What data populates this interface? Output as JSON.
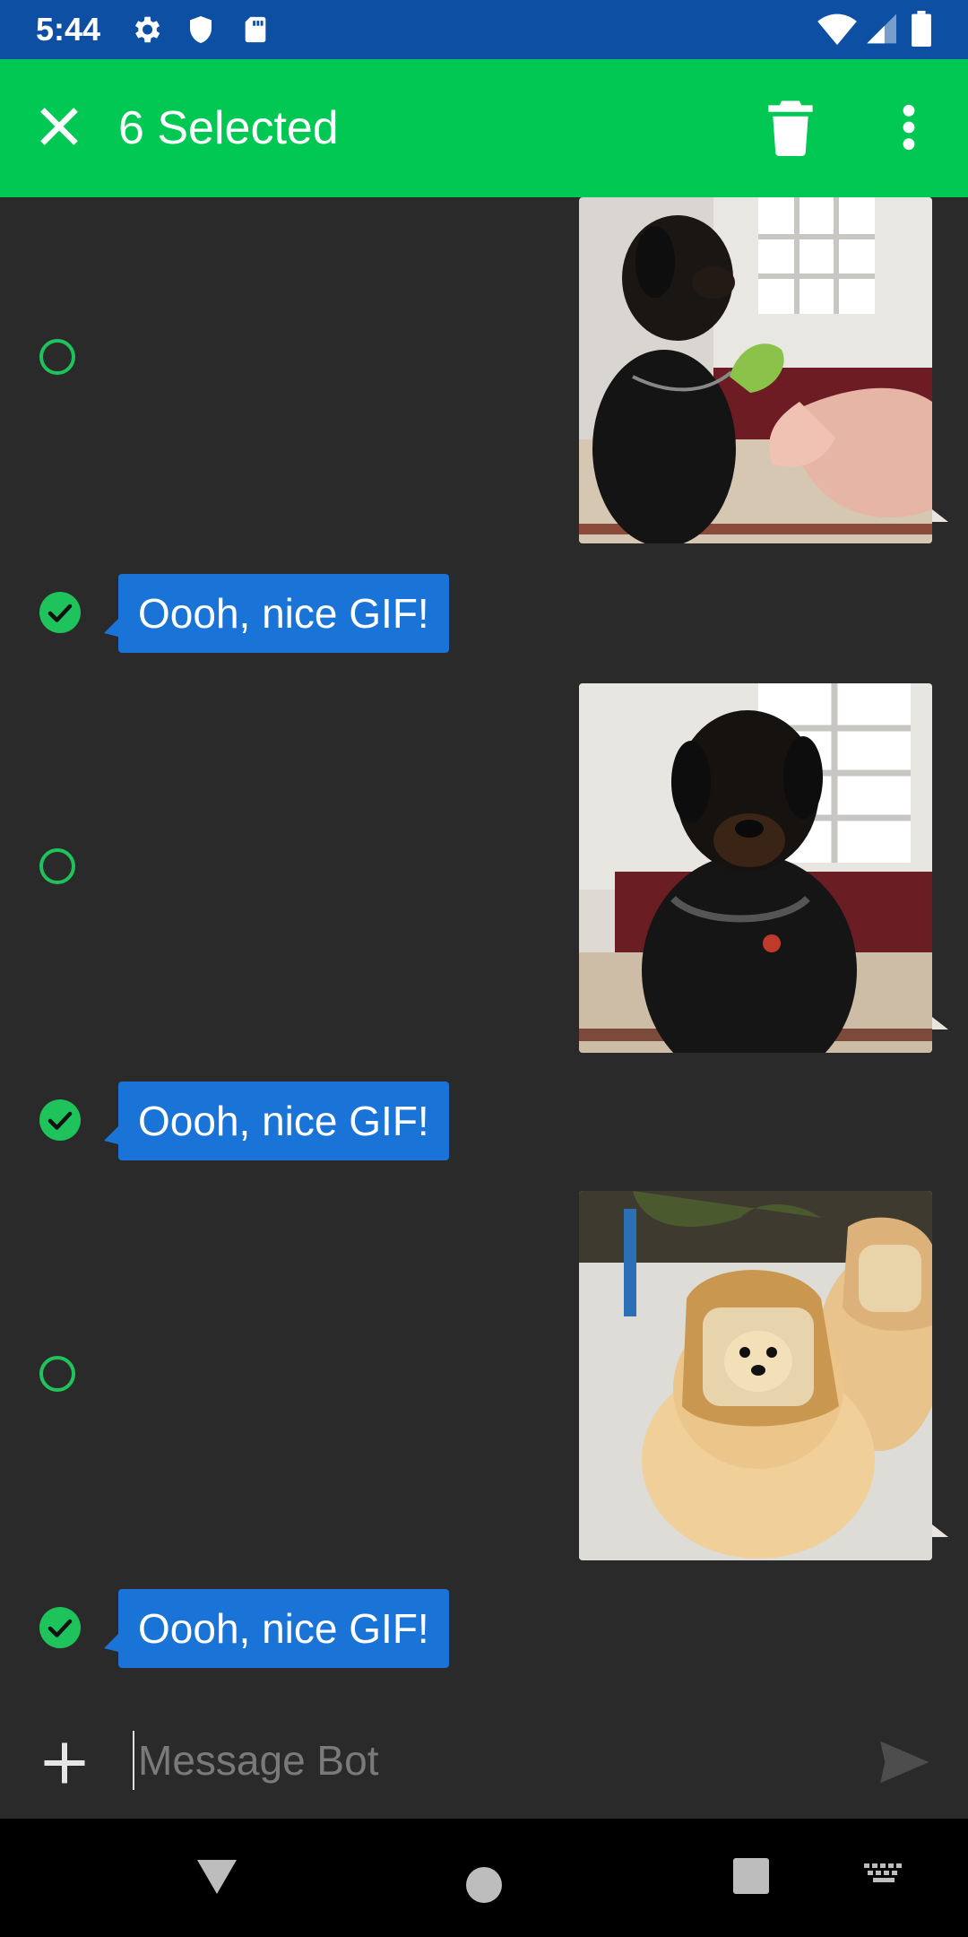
{
  "status_bar": {
    "time": "5:44",
    "left_icons": [
      "settings-icon",
      "shield-icon",
      "sd-card-icon"
    ],
    "right_icons": [
      "wifi-icon",
      "signal-icon",
      "battery-icon"
    ],
    "background": "#0d4fa3"
  },
  "app_bar": {
    "title": "6 Selected",
    "background": "#00c853",
    "close_icon": "close-icon",
    "delete_icon": "trash-icon",
    "more_icon": "more-vert-icon"
  },
  "messages": [
    {
      "type": "gif",
      "selected": false,
      "description": "rottweiler-eating-lettuce"
    },
    {
      "type": "text",
      "selected": true,
      "text": "Oooh, nice GIF!"
    },
    {
      "type": "gif",
      "selected": false,
      "description": "rottweiler-sitting"
    },
    {
      "type": "text",
      "selected": true,
      "text": "Oooh, nice GIF!"
    },
    {
      "type": "gif",
      "selected": false,
      "description": "pomeranians-with-bread"
    },
    {
      "type": "text",
      "selected": true,
      "text": "Oooh, nice GIF!"
    }
  ],
  "composer": {
    "placeholder": "Message Bot",
    "value": "",
    "add_icon": "plus-icon",
    "send_icon": "send-icon"
  },
  "nav_bar": {
    "icons": [
      "back-triangle-icon",
      "home-circle-icon",
      "recents-square-icon",
      "keyboard-icon"
    ]
  },
  "colors": {
    "accent_green": "#00c853",
    "check_green": "#1fc35b",
    "bubble_blue": "#1a73d6",
    "background": "#2a2a2a"
  }
}
